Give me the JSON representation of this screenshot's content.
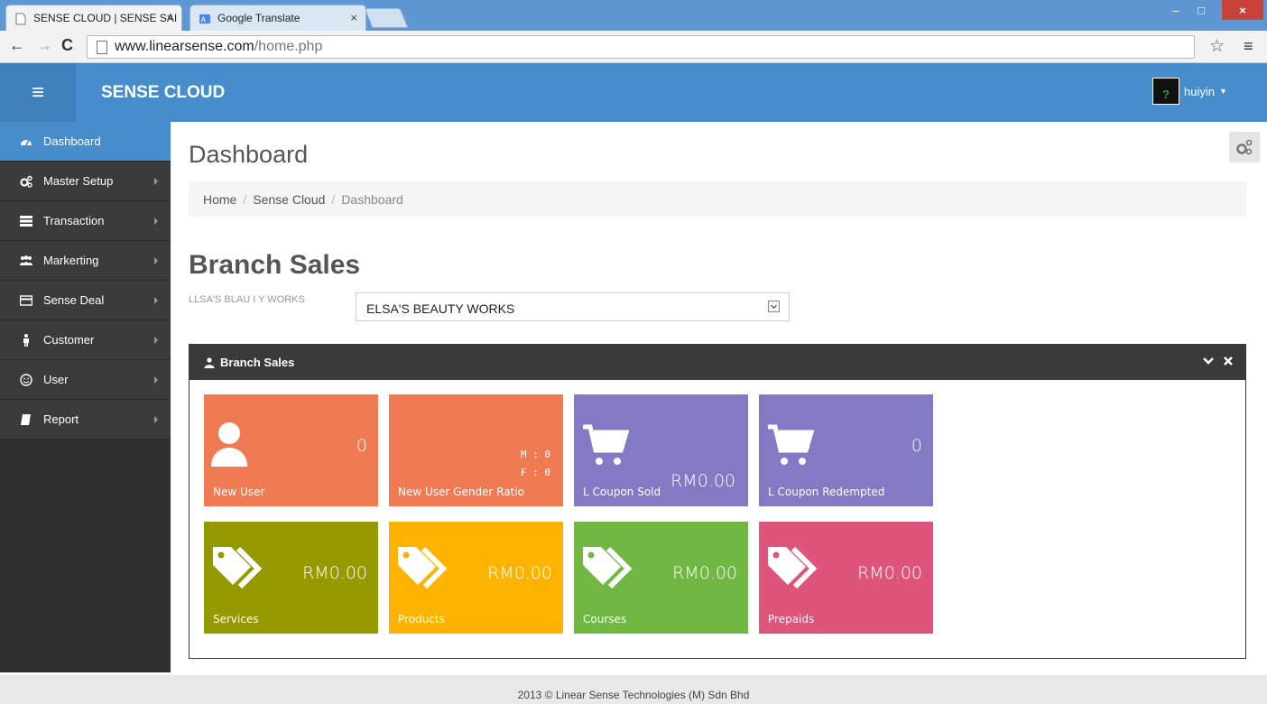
{
  "browser": {
    "tabs": [
      {
        "title": "SENSE CLOUD | SENSE SAI",
        "active": true
      },
      {
        "title": "Google Translate",
        "active": false
      }
    ],
    "url_host": "www.linearsense.com",
    "url_path": "/home.php",
    "window_buttons": {
      "minimize": "–",
      "maximize": "□",
      "close": "×"
    }
  },
  "header": {
    "brand": "SENSE CLOUD",
    "user_name": "huiyin"
  },
  "sidebar": {
    "items": [
      {
        "label": "Dashboard",
        "icon": "dashboard-icon",
        "active": true,
        "has_children": false
      },
      {
        "label": "Master Setup",
        "icon": "cogs-icon",
        "active": false,
        "has_children": true
      },
      {
        "label": "Transaction",
        "icon": "server-icon",
        "active": false,
        "has_children": true
      },
      {
        "label": "Markerting",
        "icon": "users-icon",
        "active": false,
        "has_children": true
      },
      {
        "label": "Sense Deal",
        "icon": "card-icon",
        "active": false,
        "has_children": true
      },
      {
        "label": "Customer",
        "icon": "person-icon",
        "active": false,
        "has_children": true
      },
      {
        "label": "User",
        "icon": "smile-icon",
        "active": false,
        "has_children": true
      },
      {
        "label": "Report",
        "icon": "book-icon",
        "active": false,
        "has_children": true
      }
    ]
  },
  "main": {
    "title": "Dashboard",
    "breadcrumb": [
      "Home",
      "Sense Cloud",
      "Dashboard"
    ],
    "section_title": "Branch Sales",
    "branch_label": "LLSA'S BLAU I Y WORKS",
    "branch_selected": "ELSA'S BEAUTY WORKS",
    "panel_title": "Branch Sales",
    "tiles": [
      {
        "label": "New User",
        "value": "0",
        "color": "#f07b52",
        "icon": "user-icon"
      },
      {
        "label": "New User Gender Ratio",
        "male": "M : 0",
        "female": "F : 0",
        "color": "#f07b52"
      },
      {
        "label": "L Coupon Sold",
        "value": "RM0.00",
        "color": "#8479c5",
        "icon": "cart-icon"
      },
      {
        "label": "L Coupon Redempted",
        "value": "0",
        "color": "#8479c5",
        "icon": "cart-icon"
      },
      {
        "label": "Services",
        "value": "RM0.00",
        "color": "#959a00",
        "icon": "tags-icon"
      },
      {
        "label": "Products",
        "value": "RM0.00",
        "color": "#fdb300",
        "icon": "tags-icon"
      },
      {
        "label": "Courses",
        "value": "RM0.00",
        "color": "#70b744",
        "icon": "tags-icon"
      },
      {
        "label": "Prepaids",
        "value": "RM0.00",
        "color": "#de547a",
        "icon": "tags-icon"
      }
    ]
  },
  "footer": {
    "text": "2013 © Linear Sense Technologies (M) Sdn Bhd"
  },
  "colors": {
    "header": "#478dcb",
    "sidebar": "#303030",
    "panel_header": "#3a3a3a"
  }
}
